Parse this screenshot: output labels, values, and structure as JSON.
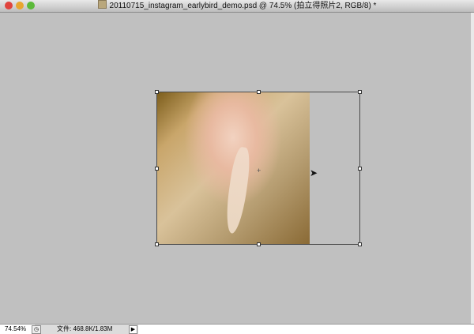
{
  "window": {
    "title": "20110715_instagram_earlybird_demo.psd @ 74.5% (拍立得照片2, RGB/8) *",
    "traffic_lights": {
      "close": "#e0443e",
      "minimize": "#e8a630",
      "zoom": "#5cba3a"
    }
  },
  "status": {
    "zoom": "74.54%",
    "doc_info": "文件: 468.8K/1.83M",
    "menu_arrow": "▶",
    "info_icon": "◷"
  }
}
